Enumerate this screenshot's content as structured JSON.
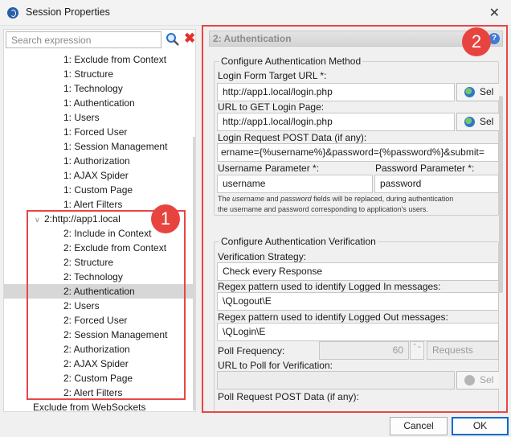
{
  "window": {
    "title": "Session Properties",
    "close_glyph": "✕"
  },
  "search": {
    "placeholder": "Search expression",
    "clear_glyph": "✖"
  },
  "tree": [
    {
      "label": "1: Exclude from Context",
      "indent": 3
    },
    {
      "label": "1: Structure",
      "indent": 3
    },
    {
      "label": "1: Technology",
      "indent": 3
    },
    {
      "label": "1: Authentication",
      "indent": 3
    },
    {
      "label": "1: Users",
      "indent": 3
    },
    {
      "label": "1: Forced User",
      "indent": 3
    },
    {
      "label": "1: Session Management",
      "indent": 3
    },
    {
      "label": "1: Authorization",
      "indent": 3
    },
    {
      "label": "1: AJAX Spider",
      "indent": 3
    },
    {
      "label": "1: Custom Page",
      "indent": 3
    },
    {
      "label": "1: Alert Filters",
      "indent": 3
    },
    {
      "label": "2:http://app1.local",
      "indent": 2,
      "expanded": true
    },
    {
      "label": "2: Include in Context",
      "indent": 3
    },
    {
      "label": "2: Exclude from Context",
      "indent": 3
    },
    {
      "label": "2: Structure",
      "indent": 3
    },
    {
      "label": "2: Technology",
      "indent": 3
    },
    {
      "label": "2: Authentication",
      "indent": 3,
      "selected": true
    },
    {
      "label": "2: Users",
      "indent": 3
    },
    {
      "label": "2: Forced User",
      "indent": 3
    },
    {
      "label": "2: Session Management",
      "indent": 3
    },
    {
      "label": "2: Authorization",
      "indent": 3
    },
    {
      "label": "2: AJAX Spider",
      "indent": 3
    },
    {
      "label": "2: Custom Page",
      "indent": 3
    },
    {
      "label": "2: Alert Filters",
      "indent": 3
    },
    {
      "label": "Exclude from WebSockets",
      "indent": 1
    }
  ],
  "panel": {
    "title": "2: Authentication",
    "help_glyph": "?",
    "method": {
      "legend": "Configure Authentication Method",
      "login_form_label": "Login Form Target URL *:",
      "login_form_value": "http://app1.local/login.php",
      "get_login_label": "URL to GET Login Page:",
      "get_login_value": "http://app1.local/login.php",
      "post_data_label": "Login Request POST Data (if any):",
      "post_data_value": "ername={%username%}&password={%password%}&submit=",
      "username_param_label": "Username Parameter *:",
      "username_param_value": "username",
      "password_param_label": "Password Parameter *:",
      "password_param_value": "password",
      "select_label": "Sel",
      "note_pre": "The ",
      "note_username": "username",
      "note_and": " and ",
      "note_password": "password",
      "note_rest": " fields will be replaced, during authentication",
      "note_line2": "the username and password corresponding to application's users."
    },
    "verification": {
      "legend": "Configure Authentication Verification",
      "strategy_label": "Verification Strategy:",
      "strategy_value": "Check every Response",
      "logged_in_label": "Regex pattern used to identify Logged In messages:",
      "logged_in_value": "\\QLogout\\E",
      "logged_out_label": "Regex pattern used to identify Logged Out messages:",
      "logged_out_value": "\\QLogin\\E",
      "poll_freq_label": "Poll Frequency:",
      "poll_freq_value": "60",
      "spinner_glyph": "⌃⌄",
      "poll_unit_value": "Requests",
      "poll_url_label": "URL to Poll for Verification:",
      "poll_url_value": "",
      "poll_post_label": "Poll Request POST Data (if any):",
      "select_label": "Sel"
    }
  },
  "buttons": {
    "cancel": "Cancel",
    "ok": "OK"
  },
  "annotations": {
    "one": "1",
    "two": "2"
  },
  "colors": {
    "annotation": "#e84646",
    "accent": "#0b6bc7"
  },
  "icons": [
    "app-logo-icon",
    "search-icon",
    "clear-icon",
    "help-icon",
    "globe-icon",
    "chevron-down-icon"
  ]
}
